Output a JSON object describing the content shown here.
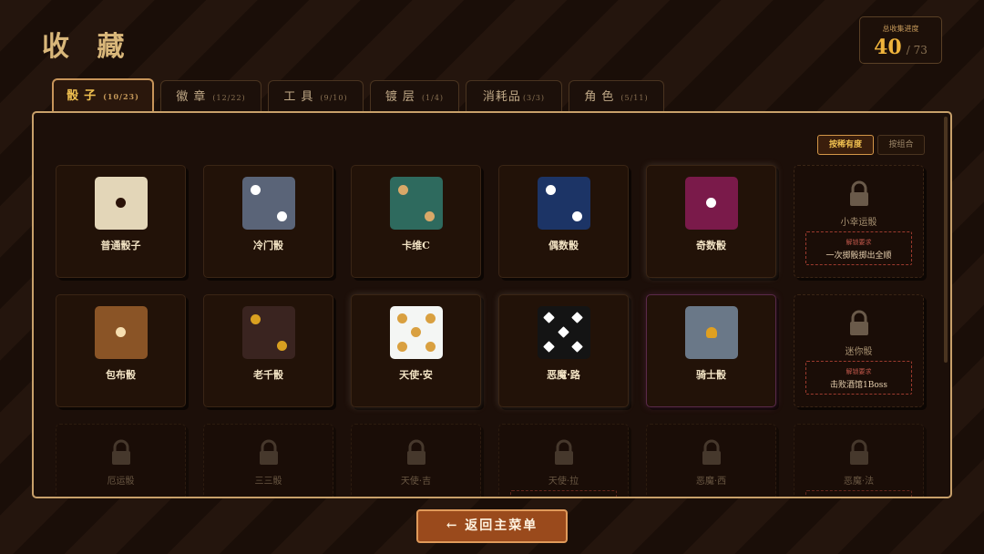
{
  "page": {
    "title": "收 藏"
  },
  "progress": {
    "label": "总收集进度",
    "current": "40",
    "total": "/ 73"
  },
  "tabs": [
    {
      "name": "骰子",
      "count": "(10/23)"
    },
    {
      "name": "徽章",
      "count": "(12/22)"
    },
    {
      "name": "工具",
      "count": "(9/10)"
    },
    {
      "name": "镀层",
      "count": "(1/4)"
    },
    {
      "name": "消耗品",
      "count": "(3/3)"
    },
    {
      "name": "角色",
      "count": "(5/11)"
    }
  ],
  "sort": {
    "by_rarity": "按稀有度",
    "by_combo": "按组合"
  },
  "cards": [
    {
      "name": "普通骰子"
    },
    {
      "name": "冷门骰"
    },
    {
      "name": "卡维C"
    },
    {
      "name": "偶数骰"
    },
    {
      "name": "奇数骰"
    },
    {
      "name": "小幸运骰",
      "req_title": "解锁要求",
      "req": "一次掷骰掷出全顺"
    },
    {
      "name": "包布骰"
    },
    {
      "name": "老千骰"
    },
    {
      "name": "天使·安"
    },
    {
      "name": "恶魔·路"
    },
    {
      "name": "骑士骰"
    },
    {
      "name": "迷你骰",
      "req_title": "解锁要求",
      "req": "击败酒馆1Boss"
    },
    {
      "name": "厄运骰"
    },
    {
      "name": "三三骰"
    },
    {
      "name": "天使·吉"
    },
    {
      "name": "天使·拉"
    },
    {
      "name": "恶魔·西"
    },
    {
      "name": "恶魔·法"
    }
  ],
  "colors": {
    "accent": "#f0c050",
    "panel_border": "#c8a06a",
    "button": "#9a4a1c"
  },
  "back_button": {
    "label": "← 返回主菜单"
  }
}
